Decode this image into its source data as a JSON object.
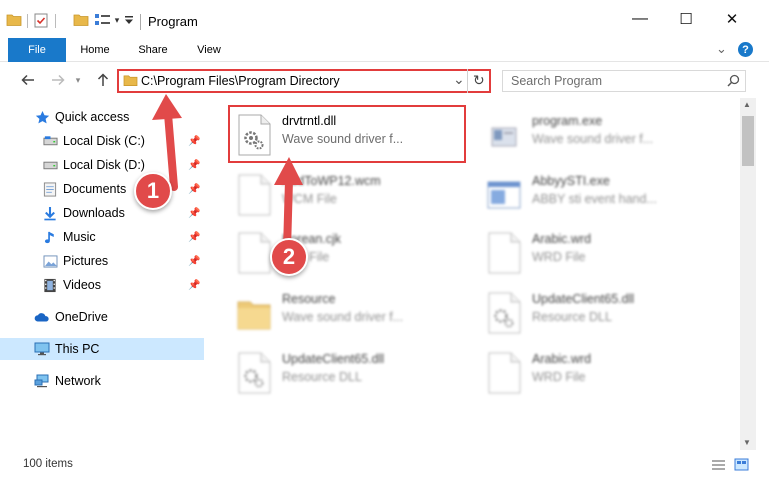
{
  "window": {
    "title": "Program",
    "minimize_glyph": "—",
    "maximize_glyph": "☐",
    "close_glyph": "✕"
  },
  "ribbon": {
    "tabs": [
      {
        "label": "File"
      },
      {
        "label": "Home"
      },
      {
        "label": "Share"
      },
      {
        "label": "View"
      }
    ],
    "help_glyph": "?",
    "expand_glyph": "⌄"
  },
  "address": {
    "path": "C:\\Program Files\\Program Directory",
    "dropdown_glyph": "⌄",
    "refresh_glyph": "↻"
  },
  "search": {
    "placeholder": "Search Program"
  },
  "sidebar": {
    "items": [
      {
        "label": "Quick access",
        "icon": "star-icon"
      },
      {
        "label": "Local Disk (C:)",
        "icon": "drive-icon"
      },
      {
        "label": "Local Disk (D:)",
        "icon": "drive-icon"
      },
      {
        "label": "Documents",
        "icon": "documents-icon"
      },
      {
        "label": "Downloads",
        "icon": "download-arrow-icon"
      },
      {
        "label": "Music",
        "icon": "music-note-icon"
      },
      {
        "label": "Pictures",
        "icon": "pictures-icon"
      },
      {
        "label": "Videos",
        "icon": "film-icon"
      },
      {
        "label": "OneDrive",
        "icon": "cloud-icon"
      },
      {
        "label": "This PC",
        "icon": "monitor-icon"
      },
      {
        "label": "Network",
        "icon": "network-icon"
      }
    ]
  },
  "files": [
    {
      "name": "drvtrntl.dll",
      "type": "Wave sound driver f...",
      "icon": "dll-gear-icon"
    },
    {
      "name": "program.exe",
      "type": "Wave sound driver f...",
      "icon": "exe-icon"
    },
    {
      "name": "AddToWP12.wcm",
      "type": "WCM File",
      "icon": "blank-file-icon"
    },
    {
      "name": "AbbyySTI.exe",
      "type": "ABBY sti event hand...",
      "icon": "exe-window-icon"
    },
    {
      "name": "Korean.cjk",
      "type": "CJK File",
      "icon": "blank-file-icon"
    },
    {
      "name": "Arabic.wrd",
      "type": "WRD File",
      "icon": "blank-file-icon"
    },
    {
      "name": "Resource",
      "type": "Wave sound driver f...",
      "icon": "folder-icon"
    },
    {
      "name": "UpdateClient65.dll",
      "type": "Resource DLL",
      "icon": "dll-gear-icon"
    },
    {
      "name": "UpdateClient65.dll",
      "type": "Resource DLL",
      "icon": "dll-gear-icon"
    },
    {
      "name": "Arabic.wrd",
      "type": "WRD File",
      "icon": "blank-file-icon"
    }
  ],
  "status": {
    "item_count": "100 items"
  },
  "annotations": {
    "step1": "1",
    "step2": "2"
  },
  "colors": {
    "highlight": "#e23c3c",
    "file_tab": "#1979ca",
    "selected_nav": "#cce8ff",
    "badge": "#e14a4a"
  }
}
